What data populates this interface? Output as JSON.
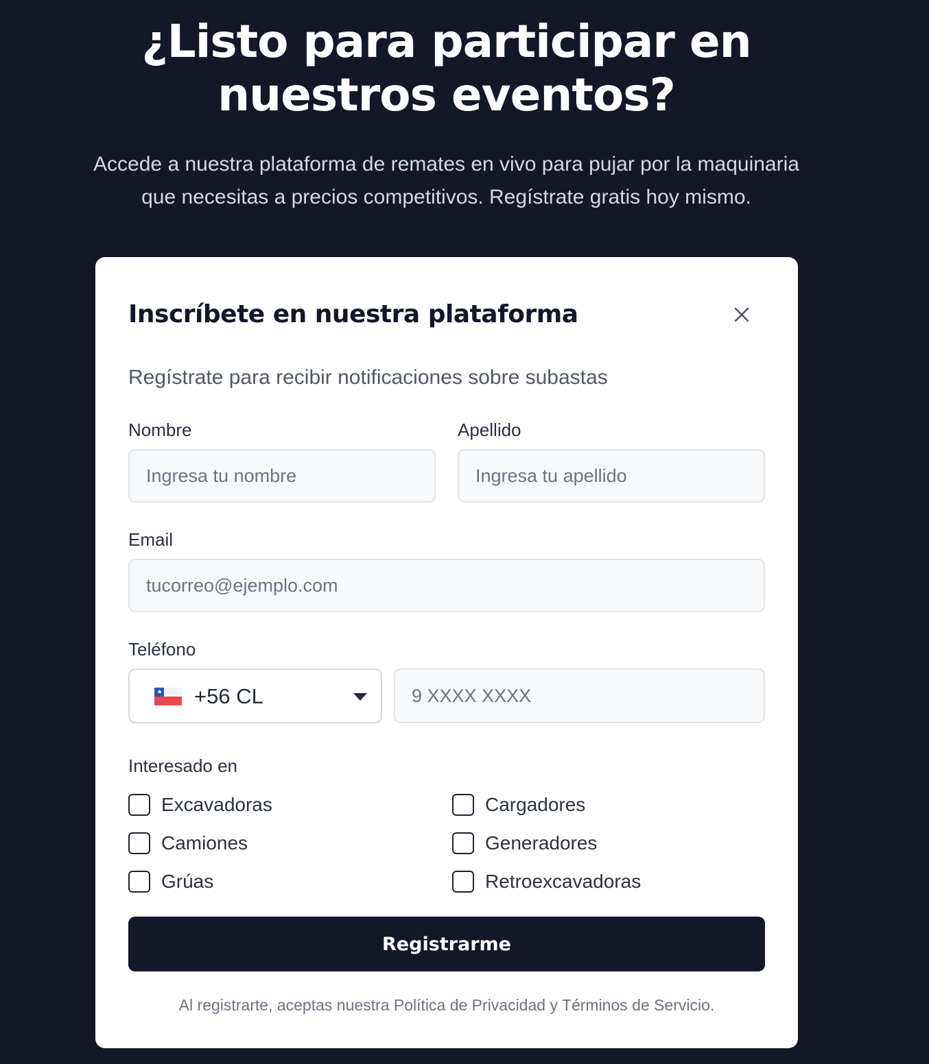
{
  "hero": {
    "title_line1": "¿Listo para participar en",
    "title_line2": "nuestros eventos?",
    "subtitle_line1": "Accede a nuestra plataforma de remates en vivo para pujar por la maquinaria",
    "subtitle_line2": "que necesitas a precios competitivos. Regístrate gratis hoy mismo."
  },
  "form": {
    "title": "Inscríbete en nuestra plataforma",
    "description": "Regístrate para recibir notificaciones sobre subastas",
    "first_name": {
      "label": "Nombre",
      "placeholder": "Ingresa tu nombre",
      "value": ""
    },
    "last_name": {
      "label": "Apellido",
      "placeholder": "Ingresa tu apellido",
      "value": ""
    },
    "email": {
      "label": "Email",
      "placeholder": "tucorreo@ejemplo.com",
      "value": ""
    },
    "phone": {
      "label": "Teléfono",
      "country_code": "+56 CL",
      "country_flag": "chile-flag-icon",
      "placeholder": "9 XXXX XXXX",
      "value": ""
    },
    "interests": {
      "label": "Interesado en",
      "options": [
        {
          "label": "Excavadoras",
          "checked": false
        },
        {
          "label": "Cargadores",
          "checked": false
        },
        {
          "label": "Camiones",
          "checked": false
        },
        {
          "label": "Generadores",
          "checked": false
        },
        {
          "label": "Grúas",
          "checked": false
        },
        {
          "label": "Retroexcavadoras",
          "checked": false
        }
      ]
    },
    "submit_label": "Registrarme",
    "legal_text": "Al registrarte, aceptas nuestra Política de Privacidad y Términos de Servicio."
  },
  "colors": {
    "background": "#131728",
    "card": "#ffffff",
    "primary_button": "#121729",
    "input_background": "#f8f9fa"
  }
}
